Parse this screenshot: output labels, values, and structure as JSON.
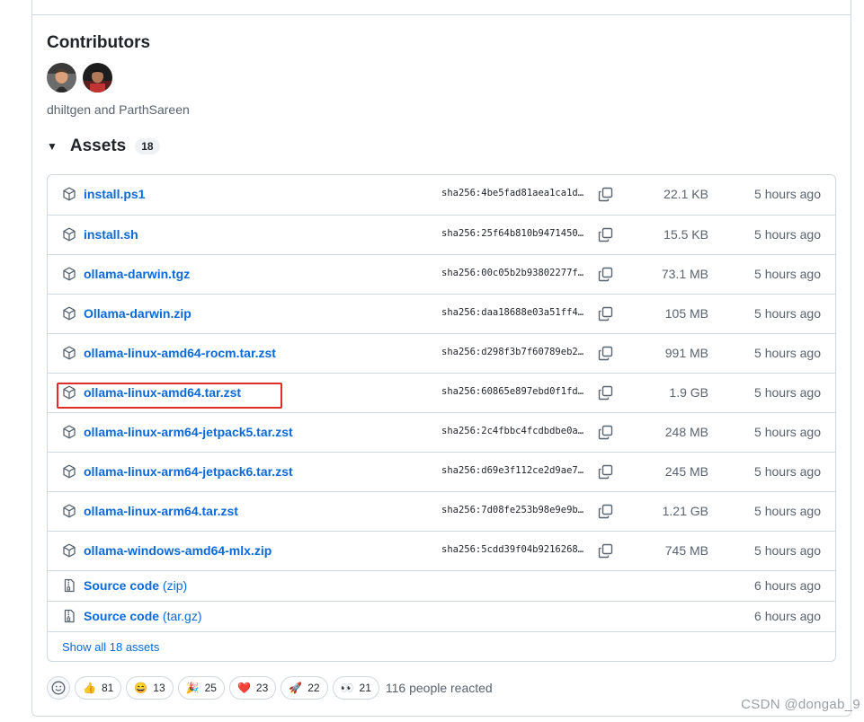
{
  "contributors": {
    "title": "Contributors",
    "names": "dhiltgen and ParthSareen"
  },
  "assets": {
    "title": "Assets",
    "count": "18",
    "rows": [
      {
        "name": "install.ps1",
        "sha": "sha256:4be5fad81aea1ca1d…",
        "size": "22.1 KB",
        "time": "5 hours ago"
      },
      {
        "name": "install.sh",
        "sha": "sha256:25f64b810b9471450…",
        "size": "15.5 KB",
        "time": "5 hours ago"
      },
      {
        "name": "ollama-darwin.tgz",
        "sha": "sha256:00c05b2b93802277f…",
        "size": "73.1 MB",
        "time": "5 hours ago"
      },
      {
        "name": "Ollama-darwin.zip",
        "sha": "sha256:daa18688e03a51ff4…",
        "size": "105 MB",
        "time": "5 hours ago"
      },
      {
        "name": "ollama-linux-amd64-rocm.tar.zst",
        "sha": "sha256:d298f3b7f60789eb2…",
        "size": "991 MB",
        "time": "5 hours ago"
      },
      {
        "name": "ollama-linux-amd64.tar.zst",
        "sha": "sha256:60865e897ebd0f1fd…",
        "size": "1.9 GB",
        "time": "5 hours ago"
      },
      {
        "name": "ollama-linux-arm64-jetpack5.tar.zst",
        "sha": "sha256:2c4fbbc4fcdbdbe0a…",
        "size": "248 MB",
        "time": "5 hours ago"
      },
      {
        "name": "ollama-linux-arm64-jetpack6.tar.zst",
        "sha": "sha256:d69e3f112ce2d9ae7…",
        "size": "245 MB",
        "time": "5 hours ago"
      },
      {
        "name": "ollama-linux-arm64.tar.zst",
        "sha": "sha256:7d08fe253b98e9e9b…",
        "size": "1.21 GB",
        "time": "5 hours ago"
      },
      {
        "name": "ollama-windows-amd64-mlx.zip",
        "sha": "sha256:5cdd39f04b9216268…",
        "size": "745 MB",
        "time": "5 hours ago"
      }
    ],
    "source_rows": [
      {
        "name": "Source code",
        "sub": "(zip)",
        "time": "6 hours ago"
      },
      {
        "name": "Source code",
        "sub": "(tar.gz)",
        "time": "6 hours ago"
      }
    ],
    "show_all": "Show all 18 assets"
  },
  "reactions": {
    "items": [
      {
        "emoji": "👍",
        "count": "81"
      },
      {
        "emoji": "😄",
        "count": "13"
      },
      {
        "emoji": "🎉",
        "count": "25"
      },
      {
        "emoji": "❤️",
        "count": "23"
      },
      {
        "emoji": "🚀",
        "count": "22"
      },
      {
        "emoji": "👀",
        "count": "21"
      }
    ],
    "summary": "116 people reacted"
  },
  "watermark": "CSDN @dongab_9",
  "colors": {
    "link": "#0969da",
    "muted": "#59636e",
    "border": "#d0d7de",
    "highlight": "#e02b2b"
  }
}
